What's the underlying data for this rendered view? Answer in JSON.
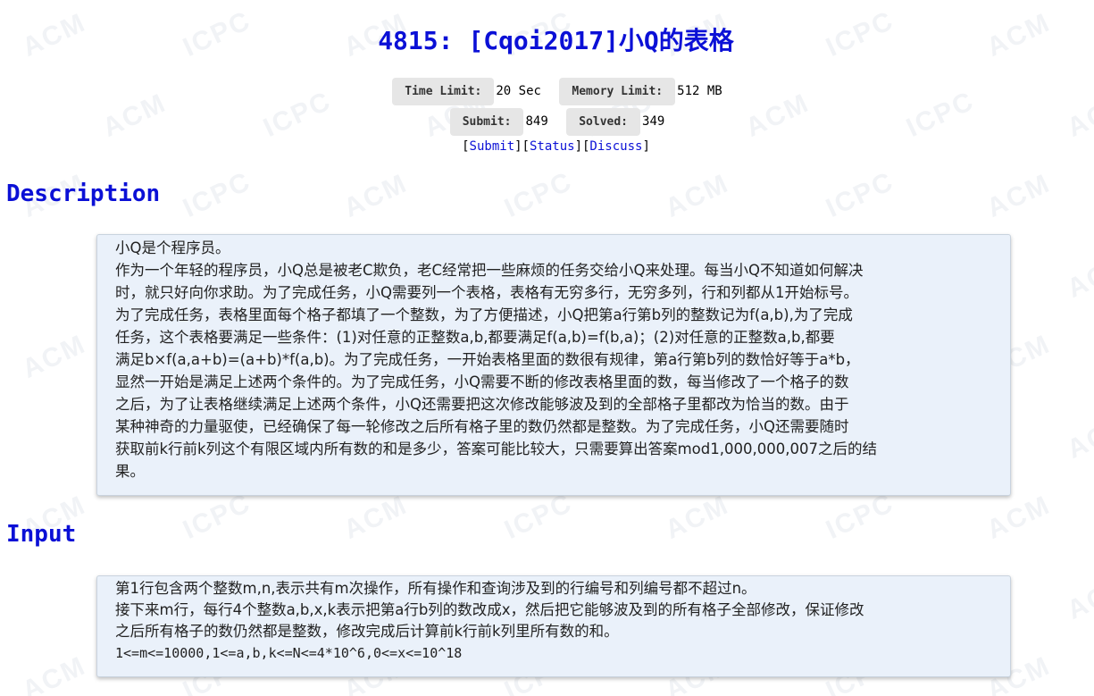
{
  "problem": {
    "title": "4815: [Cqoi2017]小Q的表格",
    "limits": {
      "time_label": "Time Limit:",
      "time_value": "20 Sec",
      "memory_label": "Memory Limit:",
      "memory_value": "512 MB",
      "submit_label": "Submit:",
      "submit_value": "849",
      "solved_label": "Solved:",
      "solved_value": "349"
    },
    "links": {
      "submit": "Submit",
      "status": "Status",
      "discuss": "Discuss"
    }
  },
  "description": {
    "heading": "Description",
    "lines": [
      "小Q是个程序员。",
      "作为一个年轻的程序员，小Q总是被老C欺负，老C经常把一些麻烦的任务交给小Q来处理。每当小Q不知道如何解决",
      "时，就只好向你求助。为了完成任务，小Q需要列一个表格，表格有无穷多行，无穷多列，行和列都从1开始标号。",
      "为了完成任务，表格里面每个格子都填了一个整数，为了方便描述，小Q把第a行第b列的整数记为f(a,b),为了完成",
      "任务，这个表格要满足一些条件：(1)对任意的正整数a,b,都要满足f(a,b)=f(b,a)；(2)对任意的正整数a,b,都要",
      "满足b×f(a,a+b)=(a+b)*f(a,b)。为了完成任务，一开始表格里面的数很有规律，第a行第b列的数恰好等于a*b，",
      "显然一开始是满足上述两个条件的。为了完成任务，小Q需要不断的修改表格里面的数，每当修改了一个格子的数",
      "之后，为了让表格继续满足上述两个条件，小Q还需要把这次修改能够波及到的全部格子里都改为恰当的数。由于",
      "某种神奇的力量驱使，已经确保了每一轮修改之后所有格子里的数仍然都是整数。为了完成任务，小Q还需要随时",
      "获取前k行前k列这个有限区域内所有数的和是多少，答案可能比较大，只需要算出答案mod1,000,000,007之后的结",
      "果。"
    ]
  },
  "input": {
    "heading": "Input",
    "lines": [
      "第1行包含两个整数m,n,表示共有m次操作，所有操作和查询涉及到的行编号和列编号都不超过n。",
      "接下来m行，每行4个整数a,b,x,k表示把第a行b列的数改成x，然后把它能够波及到的所有格子全部修改，保证修改",
      "之后所有格子的数仍然都是整数，修改完成后计算前k行前k列里所有数的和。",
      "1<=m<=10000,1<=a,b,k<=N<=4*10^6,0<=x<=10^18"
    ]
  }
}
